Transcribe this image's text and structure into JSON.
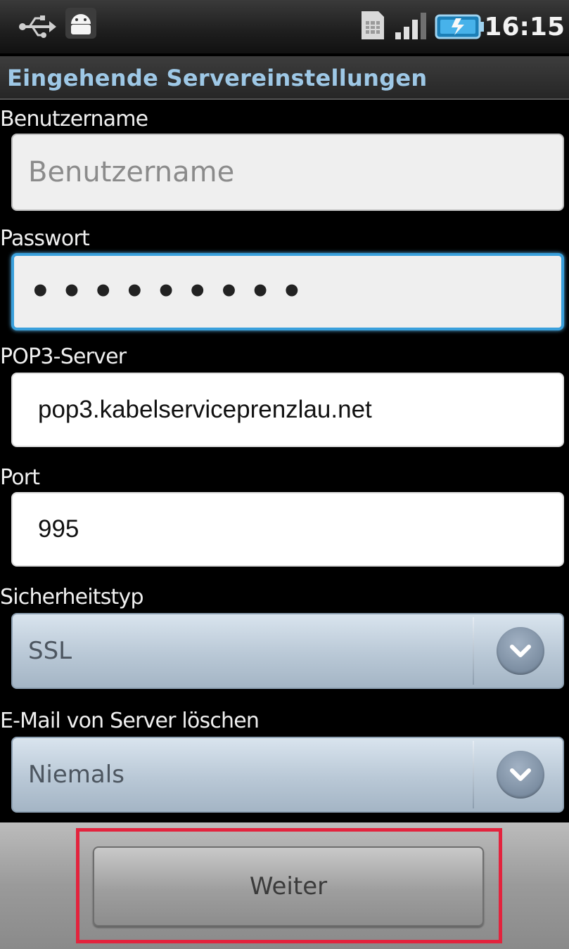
{
  "status_bar": {
    "time": "16:15",
    "icons": [
      "usb-icon",
      "android-notification-icon",
      "sim-icon",
      "signal-icon",
      "battery-icon"
    ]
  },
  "header": {
    "title": "Eingehende Servereinstellungen"
  },
  "form": {
    "username": {
      "label": "Benutzername",
      "placeholder": "Benutzername",
      "value": ""
    },
    "password": {
      "label": "Passwort",
      "value": "•••••••••"
    },
    "pop3_server": {
      "label": "POP3-Server",
      "value": "pop3.kabelserviceprenzlau.net"
    },
    "port": {
      "label": "Port",
      "value": "995"
    },
    "security_type": {
      "label": "Sicherheitstyp",
      "value": "SSL"
    },
    "delete_email": {
      "label": "E-Mail von Server löschen",
      "value": "Niemals"
    }
  },
  "footer": {
    "next_label": "Weiter"
  },
  "colors": {
    "title_text": "#9ec8e6",
    "focus_border": "#3aa0dc",
    "highlight": "#e3233d"
  }
}
